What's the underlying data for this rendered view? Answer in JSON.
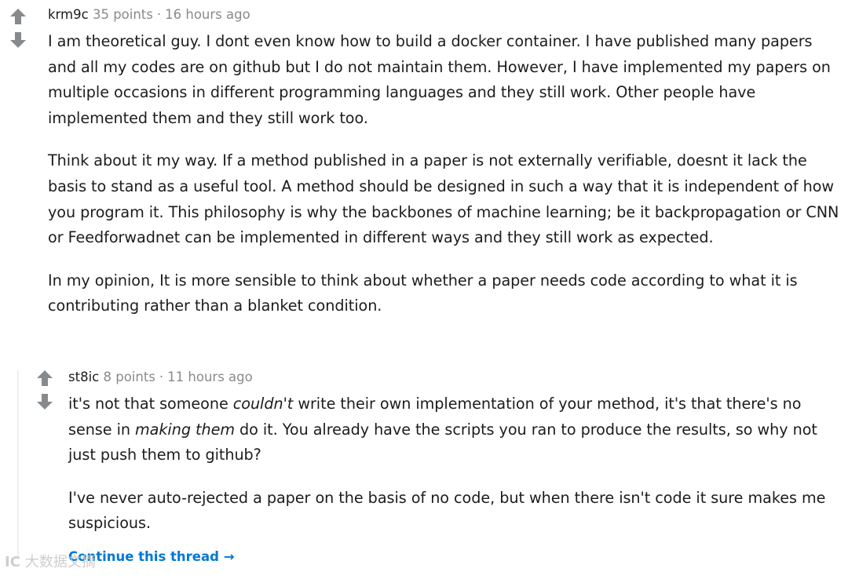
{
  "parent_comment": {
    "author": "krm9c",
    "points": "35 points",
    "separator": "·",
    "time": "16 hours ago",
    "paragraphs": [
      "I am theoretical guy. I dont even know how to build a docker container. I have published many papers and all my codes are on github but I do not maintain them. However, I have implemented my papers on multiple occasions in different programming languages and they still work. Other people have implemented them and they still work too.",
      "Think about it my way. If a method published in a paper is not externally verifiable, doesnt it lack the basis to stand as a useful tool. A method should be designed in such a way that it is independent of how you program it. This philosophy is why the backbones of machine learning; be it backpropagation or CNN or Feedforwadnet can be implemented in different ways and they still work as expected.",
      "In my opinion, It is more sensible to think about whether a paper needs code according to what it is contributing rather than a blanket condition."
    ]
  },
  "reply_comment": {
    "author": "st8ic",
    "points": "8 points",
    "separator": "·",
    "time": "11 hours ago",
    "p1_part1": "it's not that someone ",
    "p1_em1": "couldn't",
    "p1_part2": " write their own implementation of your method, it's that there's no sense in ",
    "p1_em2": "making them",
    "p1_part3": " do it. You already have the scripts you ran to produce the results, so why not just push them to github?",
    "p2": "I've never auto-rejected a paper on the basis of no code, but when there isn't code it sure makes me suspicious."
  },
  "continue_link": {
    "label": "Continue this thread",
    "arrow": "→"
  },
  "watermark": {
    "logo": "IC",
    "text": "大数据文摘"
  },
  "icons": {
    "upvote": "arrow-up",
    "downvote": "arrow-down"
  },
  "colors": {
    "vote_arrow": "#878a8c",
    "link": "#0079d3",
    "meta": "#878a8c",
    "text": "#1c1c1c"
  }
}
